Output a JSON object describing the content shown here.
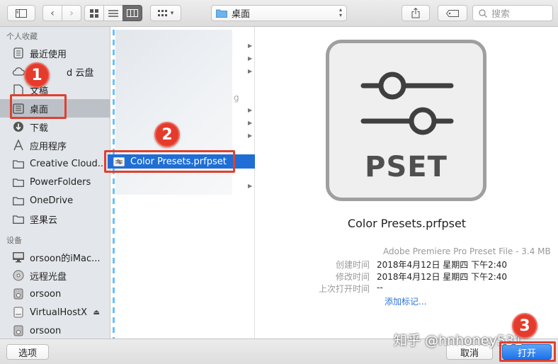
{
  "toolbar": {
    "location": "桌面",
    "search_placeholder": "搜索"
  },
  "sidebar": {
    "favorites_header": "个人收藏",
    "favorites": [
      {
        "label": "最近使用",
        "icon": "recents-icon"
      },
      {
        "label": "d 云盘",
        "icon": "icloud-icon"
      },
      {
        "label": "文稿",
        "icon": "documents-icon"
      },
      {
        "label": "桌面",
        "icon": "desktop-icon",
        "selected": true
      },
      {
        "label": "下载",
        "icon": "downloads-icon"
      },
      {
        "label": "应用程序",
        "icon": "applications-icon"
      },
      {
        "label": "Creative Cloud...",
        "icon": "folder-icon"
      },
      {
        "label": "PowerFolders",
        "icon": "folder-icon"
      },
      {
        "label": "OneDrive",
        "icon": "folder-icon"
      },
      {
        "label": "坚果云",
        "icon": "folder-icon"
      }
    ],
    "devices_header": "设备",
    "devices": [
      {
        "label": "orsoon的iMac...",
        "icon": "imac-icon"
      },
      {
        "label": "远程光盘",
        "icon": "disc-icon"
      },
      {
        "label": "orsoon",
        "icon": "drive-icon"
      },
      {
        "label": "VirtualHostX",
        "icon": "drive-icon"
      },
      {
        "label": "orsoon",
        "icon": "drive-icon"
      }
    ]
  },
  "column": {
    "partial_text": "g",
    "selected_file": "Color Presets.prfpset"
  },
  "preview": {
    "icon_text": "PSET",
    "file_name": "Color Presets.prfpset",
    "kind": "Adobe Premiere Pro Preset File - 3.4 MB",
    "meta": [
      {
        "key": "创建时间",
        "value": "2018年4月12日 星期四 下午2:40"
      },
      {
        "key": "修改时间",
        "value": "2018年4月12日 星期四 下午2:40"
      },
      {
        "key": "上次打开时间",
        "value": "--"
      }
    ],
    "add_tags": "添加标记..."
  },
  "bottom": {
    "options": "选项",
    "cancel": "取消",
    "open": "打开"
  },
  "annotations": {
    "step1": "1",
    "step2": "2",
    "step3": "3",
    "accent": "#e43b2c"
  },
  "watermark": "知乎 @hnhoney531"
}
